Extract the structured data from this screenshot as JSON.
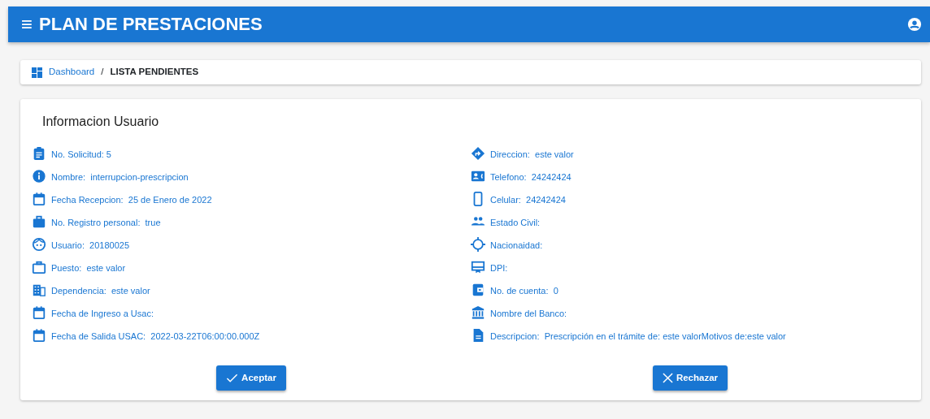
{
  "header": {
    "menu_icon": "≡",
    "title": "PLAN DE PRESTACIONES"
  },
  "breadcrumb": {
    "link": "Dashboard",
    "separator": "/",
    "current": "LISTA PENDIENTES"
  },
  "card": {
    "title": "Informacion Usuario",
    "left_fields": [
      "No. Solicitud: 5",
      "Nombre:  interrupcion-prescripcion",
      "Fecha Recepcion:  25 de Enero de 2022",
      "No. Registro personal:  true",
      "Usuario:  20180025",
      "Puesto:  este valor",
      "Dependencia:  este valor",
      "Fecha de Ingreso a Usac:",
      "Fecha de Salida USAC:  2022-03-22T06:00:00.000Z"
    ],
    "right_fields": [
      "Direccion:  este valor",
      "Telefono:  24242424",
      "Celular:  24242424",
      "Estado Civil:",
      "Nacionaidad:",
      "DPI:",
      "No. de cuenta:  0",
      "Nombre del Banco:",
      "Descripcion:  Prescripción en el trámite de: este valorMotivos de:este valor"
    ],
    "buttons": [
      {
        "kind": "accept",
        "label": "Aceptar"
      },
      {
        "kind": "reject",
        "label": "Rechazar"
      }
    ]
  }
}
